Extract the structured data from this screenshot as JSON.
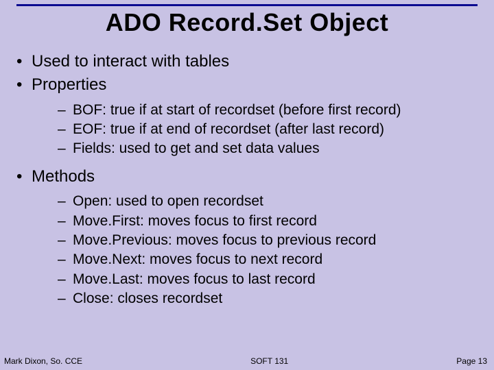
{
  "title": "ADO Record.Set Object",
  "bullets": {
    "b0": "Used to interact with tables",
    "b1": "Properties",
    "b1_sub": [
      "BOF: true if at start of recordset (before first record)",
      "EOF: true if at end of recordset (after last record)",
      "Fields: used to get and set data values"
    ],
    "b2": "Methods",
    "b2_sub": [
      "Open: used to open recordset",
      "Move.First: moves focus to first record",
      "Move.Previous: moves focus to previous record",
      "Move.Next: moves focus to next record",
      "Move.Last: moves focus to last record",
      "Close: closes recordset"
    ]
  },
  "footer": {
    "left": "Mark Dixon, So. CCE",
    "center": "SOFT 131",
    "right": "Page 13"
  }
}
